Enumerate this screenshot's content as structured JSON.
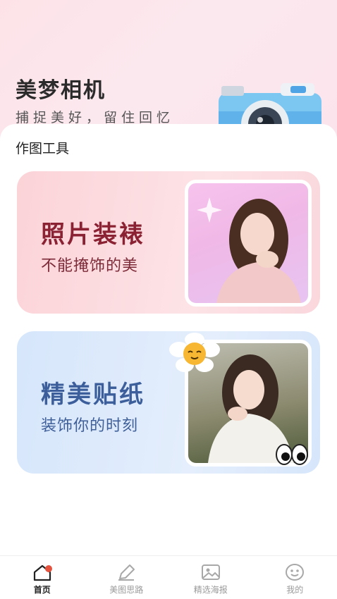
{
  "header": {
    "title": "美梦相机",
    "subtitle": "捕捉美好，留住回忆"
  },
  "section": {
    "title": "作图工具"
  },
  "cards": [
    {
      "title": "照片装裱",
      "subtitle": "不能掩饰的美"
    },
    {
      "title": "精美贴纸",
      "subtitle": "装饰你的时刻"
    }
  ],
  "tabbar": {
    "items": [
      {
        "label": "首页",
        "icon": "home-icon",
        "active": true
      },
      {
        "label": "美图思路",
        "icon": "pencil-icon",
        "active": false
      },
      {
        "label": "精选海报",
        "icon": "image-icon",
        "active": false
      },
      {
        "label": "我的",
        "icon": "smiley-icon",
        "active": false
      }
    ]
  },
  "colors": {
    "accent": "#e5533f",
    "card1_title": "#8a2233",
    "card2_title": "#3c5f9b"
  }
}
